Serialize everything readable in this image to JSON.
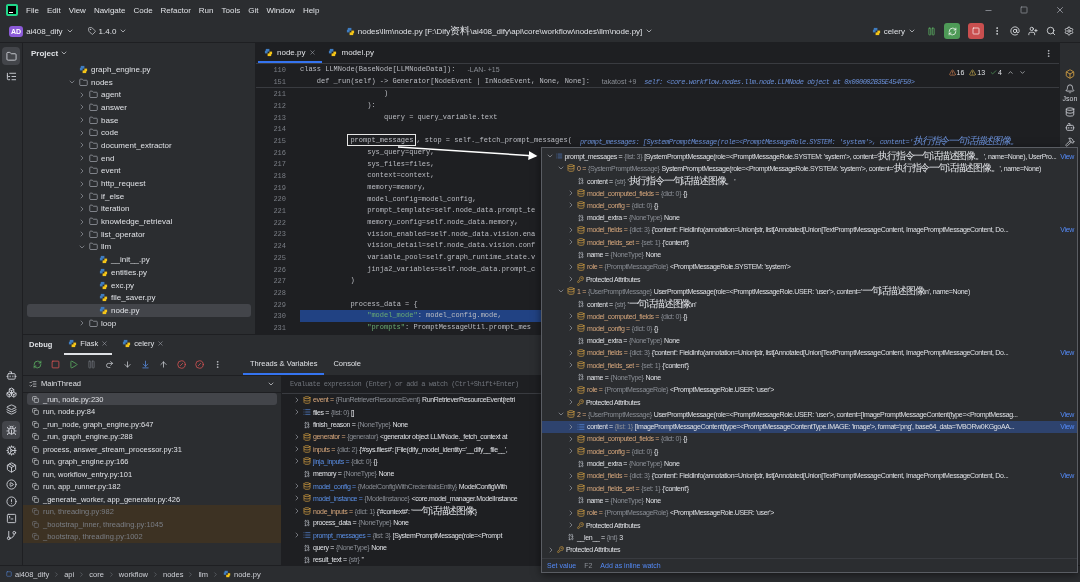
{
  "menu": [
    "File",
    "Edit",
    "View",
    "Navigate",
    "Code",
    "Refactor",
    "Run",
    "Tools",
    "Git",
    "Window",
    "Help"
  ],
  "toolbar": {
    "badge": "AD",
    "project": "ai408_dify",
    "version": "1.4.0",
    "path": "nodes\\llm\\node.py [F:\\Dify资料\\ai408_dify\\api\\core\\workflow\\nodes\\llm\\node.py]",
    "run_config": "celery"
  },
  "project_panel": {
    "title": "Project",
    "tree": [
      {
        "name": "graph_engine.py",
        "kind": "file",
        "selected": false
      },
      {
        "name": "nodes",
        "kind": "folder",
        "expanded": true,
        "selected": false,
        "children": [
          {
            "name": "agent",
            "kind": "folder",
            "expanded": false,
            "selected": false
          },
          {
            "name": "answer",
            "kind": "folder",
            "expanded": false,
            "selected": false
          },
          {
            "name": "base",
            "kind": "folder",
            "expanded": false,
            "selected": false
          },
          {
            "name": "code",
            "kind": "folder",
            "expanded": false,
            "selected": false
          },
          {
            "name": "document_extractor",
            "kind": "folder",
            "expanded": false,
            "selected": false
          },
          {
            "name": "end",
            "kind": "folder",
            "expanded": false,
            "selected": false
          },
          {
            "name": "event",
            "kind": "folder",
            "expanded": false,
            "selected": false
          },
          {
            "name": "http_request",
            "kind": "folder",
            "expanded": false,
            "selected": false
          },
          {
            "name": "if_else",
            "kind": "folder",
            "expanded": false,
            "selected": false
          },
          {
            "name": "iteration",
            "kind": "folder",
            "expanded": false,
            "selected": false
          },
          {
            "name": "knowledge_retrieval",
            "kind": "folder",
            "expanded": false,
            "selected": false
          },
          {
            "name": "list_operator",
            "kind": "folder",
            "expanded": false,
            "selected": false
          },
          {
            "name": "llm",
            "kind": "folder",
            "expanded": true,
            "selected": false,
            "children": [
              {
                "name": "__init__.py",
                "kind": "file",
                "selected": false
              },
              {
                "name": "entities.py",
                "kind": "file",
                "selected": false
              },
              {
                "name": "exc.py",
                "kind": "file",
                "selected": false
              },
              {
                "name": "file_saver.py",
                "kind": "file",
                "selected": false
              },
              {
                "name": "node.py",
                "kind": "file",
                "selected": true
              }
            ]
          },
          {
            "name": "loop",
            "kind": "folder",
            "expanded": false,
            "selected": false
          }
        ]
      }
    ]
  },
  "editor": {
    "tabs": [
      {
        "label": "node.py",
        "selected": true
      },
      {
        "label": "model.py",
        "selected": false
      }
    ],
    "inspections": {
      "errors": "16",
      "warnings": "13",
      "passed": "4"
    },
    "sticky_lines": [
      {
        "number": "110",
        "code": "class LLMNode(BaseNode[LLMNodeData]):",
        "author": "-LAN- +15"
      },
      {
        "number": "151",
        "code": "    def _run(self) -> Generator[NodeEvent | InNodeEvent, None, None]:",
        "author": "takatost +9",
        "inline_value": "self: <core.workflow.nodes.llm.node.LLMNode object at 0x000002B35E454F50>"
      }
    ],
    "lines": [
      {
        "number": "211",
        "code": "                    )",
        "execution": false
      },
      {
        "number": "212",
        "code": "                ):",
        "execution": false
      },
      {
        "number": "213",
        "code": "                    query = query_variable.text",
        "execution": false
      },
      {
        "number": "214",
        "execution": false
      },
      {
        "number": "215",
        "boxed": "prompt_messages",
        "code": "            , stop = self._fetch_prompt_messages(",
        "inline_value": "prompt_messages: [SystemPromptMessage(role=<PromptMessageRole.SYSTEM: 'system'>, content='执行指令一句话描述图像。",
        "execution": false
      },
      {
        "number": "216",
        "code": "                sys_query=query,",
        "execution": false
      },
      {
        "number": "217",
        "code": "                sys_files=files,",
        "execution": false
      },
      {
        "number": "218",
        "code": "                context=context,",
        "execution": false
      },
      {
        "number": "219",
        "code": "                memory=memory,",
        "execution": false
      },
      {
        "number": "220",
        "code": "                model_config=model_config,",
        "execution": false
      },
      {
        "number": "221",
        "code": "                prompt_template=self.node_data.prompt_te",
        "execution": false
      },
      {
        "number": "222",
        "code": "                memory_config=self.node_data.memory,",
        "execution": false
      },
      {
        "number": "223",
        "code": "                vision_enabled=self.node_data.vision.ena",
        "execution": false
      },
      {
        "number": "224",
        "code": "                vision_detail=self.node_data.vision.conf",
        "execution": false
      },
      {
        "number": "225",
        "code": "                variable_pool=self.graph_runtime_state.v",
        "execution": false
      },
      {
        "number": "226",
        "code": "                jinja2_variables=self.node_data.prompt_c",
        "execution": false
      },
      {
        "number": "227",
        "code": "            )",
        "execution": false
      },
      {
        "number": "228",
        "execution": false
      },
      {
        "number": "229",
        "code": "            process_data = {",
        "execution": false
      },
      {
        "number": "230",
        "code": "                \"model_mode\": model_config.mode,",
        "execution": true
      },
      {
        "number": "231",
        "code": "                \"prompts\": PromptMessageUtil.prompt_mes",
        "execution": false
      }
    ]
  },
  "debug": {
    "title": "Debug",
    "sessions": [
      {
        "label": "Flask",
        "selected": true
      },
      {
        "label": "celery",
        "selected": false
      }
    ],
    "tabs": [
      {
        "label": "Threads & Variables",
        "selected": true
      },
      {
        "label": "Console",
        "selected": false
      }
    ],
    "thread": "MainThread",
    "frames": [
      {
        "label": "_run, node.py:230",
        "selected": true,
        "library": false
      },
      {
        "label": "run, node.py:84",
        "selected": false,
        "library": false
      },
      {
        "label": "_run_node, graph_engine.py:647",
        "selected": false,
        "library": false
      },
      {
        "label": "_run, graph_engine.py:288",
        "selected": false,
        "library": false
      },
      {
        "label": "process, answer_stream_processor.py:31",
        "selected": false,
        "library": false
      },
      {
        "label": "run, graph_engine.py:166",
        "selected": false,
        "library": false
      },
      {
        "label": "run, workflow_entry.py:101",
        "selected": false,
        "library": false
      },
      {
        "label": "run, app_runner.py:182",
        "selected": false,
        "library": false
      },
      {
        "label": "_generate_worker, app_generator.py:426",
        "selected": false,
        "library": false
      },
      {
        "label": "run, threading.py:982",
        "selected": false,
        "library": true
      },
      {
        "label": "_bootstrap_inner, threading.py:1045",
        "selected": false,
        "library": true
      },
      {
        "label": "_bootstrap, threading.py:1002",
        "selected": false,
        "library": true
      }
    ],
    "evaluate_placeholder": "Evaluate expression (Enter) or add a watch (Ctrl+Shift+Enter)",
    "variables": [
      {
        "name": "event =",
        "type": "{RunRetrieverResourceEvent}",
        "value": "RunRetrieverResourceEvent(retri",
        "kind": "object",
        "expanded": false,
        "changed": false
      },
      {
        "name": "files =",
        "type": "{list: 0}",
        "value": "[]",
        "kind": "list",
        "expanded": false,
        "changed": false
      },
      {
        "name": "finish_reason =",
        "type": "{NoneType}",
        "value": "None",
        "kind": "scalar",
        "changed": false
      },
      {
        "name": "generator =",
        "type": "{generator}",
        "value": "<generator object LLMNode._fetch_context at",
        "kind": "object",
        "expanded": false,
        "changed": false
      },
      {
        "name": "inputs =",
        "type": "{dict: 2}",
        "value": "{'#sys.files#': [File(dify_model_identity='__dify__file__',",
        "kind": "object",
        "expanded": false,
        "changed": false
      },
      {
        "name": "jinja_inputs =",
        "type": "{dict: 0}",
        "value": "{}",
        "kind": "object",
        "expanded": false,
        "changed": true
      },
      {
        "name": "memory =",
        "type": "{NoneType}",
        "value": "None",
        "kind": "scalar",
        "changed": false
      },
      {
        "name": "model_config =",
        "type": "{ModelConfigWithCredentialsEntity}",
        "value": "ModelConfigWith",
        "kind": "object",
        "expanded": false,
        "changed": true
      },
      {
        "name": "model_instance =",
        "type": "{ModelInstance}",
        "value": "<core.model_manager.ModelInstance",
        "kind": "object",
        "expanded": false,
        "changed": true
      },
      {
        "name": "node_inputs =",
        "type": "{dict: 1}",
        "value": "{'#context#': '一句话描述图像'}",
        "kind": "object",
        "expanded": false,
        "changed": false
      },
      {
        "name": "process_data =",
        "type": "{NoneType}",
        "value": "None",
        "kind": "scalar",
        "changed": false
      },
      {
        "name": "prompt_messages =",
        "type": "{list: 3}",
        "value": "[SystemPromptMessage(role=<Prompt",
        "kind": "list",
        "expanded": false,
        "changed": true
      },
      {
        "name": "query =",
        "type": "{NoneType}",
        "value": "None",
        "kind": "scalar",
        "changed": false
      },
      {
        "name": "result_text =",
        "type": "{str}",
        "value": "''",
        "kind": "scalar",
        "changed": false
      }
    ]
  },
  "popup": {
    "rows": [
      {
        "name": "prompt_messages =",
        "type": "{list: 3}",
        "value": "[SystemPromptMessage(role=<PromptMessageRole.SYSTEM: 'system'>, content='执行指令一句话描述图像。', name=None), UserPro...",
        "link": "View",
        "kind": "list",
        "expanded": true,
        "selected": false,
        "children": [
          {
            "name": "0 =",
            "type": "{SystemPromptMessage}",
            "value": "SystemPromptMessage(role=<PromptMessageRole.SYSTEM: 'system'>, content='执行指令一句话描述图像。', name=None)",
            "kind": "object",
            "expanded": true,
            "selected": false,
            "children": [
              {
                "name": "content =",
                "type": "{str}",
                "value": "'执行指令一句话描述图像。'",
                "kind": "scalar",
                "selected": false
              },
              {
                "name": "model_computed_fields =",
                "type": "{dict: 0}",
                "value": "{}",
                "kind": "object",
                "expanded": false,
                "selected": false
              },
              {
                "name": "model_config =",
                "type": "{dict: 0}",
                "value": "{}",
                "kind": "object",
                "expanded": false,
                "selected": false
              },
              {
                "name": "model_extra =",
                "type": "{NoneType}",
                "value": "None",
                "kind": "scalar",
                "selected": false
              },
              {
                "name": "model_fields =",
                "type": "{dict: 3}",
                "value": "{'content': FieldInfo(annotation=Union[str, list[Annotated[Union[TextPromptMessageContent, ImagePromptMessageContent, Do...",
                "link": "View",
                "kind": "object",
                "expanded": false,
                "selected": false
              },
              {
                "name": "model_fields_set =",
                "type": "{set: 1}",
                "value": "{'content'}",
                "kind": "object",
                "expanded": false,
                "selected": false
              },
              {
                "name": "name =",
                "type": "{NoneType}",
                "value": "None",
                "kind": "scalar",
                "selected": false
              },
              {
                "name": "role =",
                "type": "{PromptMessageRole}",
                "value": "<PromptMessageRole.SYSTEM: 'system'>",
                "kind": "object",
                "expanded": false,
                "selected": false
              },
              {
                "name": "Protected Attributes",
                "kind": "protected",
                "expanded": false,
                "selected": false
              }
            ]
          },
          {
            "name": "1 =",
            "type": "{UserPromptMessage}",
            "value": "UserPromptMessage(role=<PromptMessageRole.USER: 'user'>, content='一句话描述图像\\n', name=None)",
            "kind": "object",
            "expanded": true,
            "selected": false,
            "children": [
              {
                "name": "content =",
                "type": "{str}",
                "value": "'一句话描述图像\\n'",
                "kind": "scalar",
                "selected": false
              },
              {
                "name": "model_computed_fields =",
                "type": "{dict: 0}",
                "value": "{}",
                "kind": "object",
                "expanded": false,
                "selected": false
              },
              {
                "name": "model_config =",
                "type": "{dict: 0}",
                "value": "{}",
                "kind": "object",
                "expanded": false,
                "selected": false
              },
              {
                "name": "model_extra =",
                "type": "{NoneType}",
                "value": "None",
                "kind": "scalar",
                "selected": false
              },
              {
                "name": "model_fields =",
                "type": "{dict: 3}",
                "value": "{'content': FieldInfo(annotation=Union[str, list[Annotated[Union[TextPromptMessageContent, ImagePromptMessageContent, Do...",
                "link": "View",
                "kind": "object",
                "expanded": false,
                "selected": false
              },
              {
                "name": "model_fields_set =",
                "type": "{set: 1}",
                "value": "{'content'}",
                "kind": "object",
                "expanded": false,
                "selected": false
              },
              {
                "name": "name =",
                "type": "{NoneType}",
                "value": "None",
                "kind": "scalar",
                "selected": false
              },
              {
                "name": "role =",
                "type": "{PromptMessageRole}",
                "value": "<PromptMessageRole.USER: 'user'>",
                "kind": "object",
                "expanded": false,
                "selected": false
              },
              {
                "name": "Protected Attributes",
                "kind": "protected",
                "expanded": false,
                "selected": false
              }
            ]
          },
          {
            "name": "2 =",
            "type": "{UserPromptMessage}",
            "value": "UserPromptMessage(role=<PromptMessageRole.USER: 'user'>, content=[ImagePromptMessageContent(type=<PromptMessag...",
            "link": "View",
            "kind": "object",
            "expanded": true,
            "selected": false,
            "children": [
              {
                "name": "content =",
                "type": "{list: 1}",
                "value": "[ImagePromptMessageContent(type=<PromptMessageContentType.IMAGE: 'image'>, format='png', base64_data='iVBORw0KGgoAA...",
                "link": "View",
                "kind": "list",
                "expanded": false,
                "selected": true
              },
              {
                "name": "model_computed_fields =",
                "type": "{dict: 0}",
                "value": "{}",
                "kind": "object",
                "expanded": false,
                "selected": false
              },
              {
                "name": "model_config =",
                "type": "{dict: 0}",
                "value": "{}",
                "kind": "object",
                "expanded": false,
                "selected": false
              },
              {
                "name": "model_extra =",
                "type": "{NoneType}",
                "value": "None",
                "kind": "scalar",
                "selected": false
              },
              {
                "name": "model_fields =",
                "type": "{dict: 3}",
                "value": "{'content': FieldInfo(annotation=Union[str, list[Annotated[Union[TextPromptMessageContent, ImagePromptMessageContent, Do...",
                "link": "View",
                "kind": "object",
                "expanded": false,
                "selected": false
              },
              {
                "name": "model_fields_set =",
                "type": "{set: 1}",
                "value": "{'content'}",
                "kind": "object",
                "expanded": false,
                "selected": false
              },
              {
                "name": "name =",
                "type": "{NoneType}",
                "value": "None",
                "kind": "scalar",
                "selected": false
              },
              {
                "name": "role =",
                "type": "{PromptMessageRole}",
                "value": "<PromptMessageRole.USER: 'user'>",
                "kind": "object",
                "expanded": false,
                "selected": false
              },
              {
                "name": "Protected Attributes",
                "kind": "protected",
                "expanded": false,
                "selected": false
              }
            ]
          },
          {
            "name": "__len__ =",
            "type": "{int}",
            "value": "3",
            "kind": "scalar",
            "selected": false
          }
        ]
      },
      {
        "name": "Protected Attributes",
        "kind": "protected",
        "expanded": false,
        "selected": false
      }
    ],
    "set_value": "Set value",
    "shortcut": "F2",
    "inline_watch": "Add as inline watch"
  },
  "right_strip": {
    "label": "Json"
  },
  "breadcrumb": [
    "ai408_dify",
    "api",
    "core",
    "workflow",
    "nodes",
    "llm",
    "node.py"
  ]
}
